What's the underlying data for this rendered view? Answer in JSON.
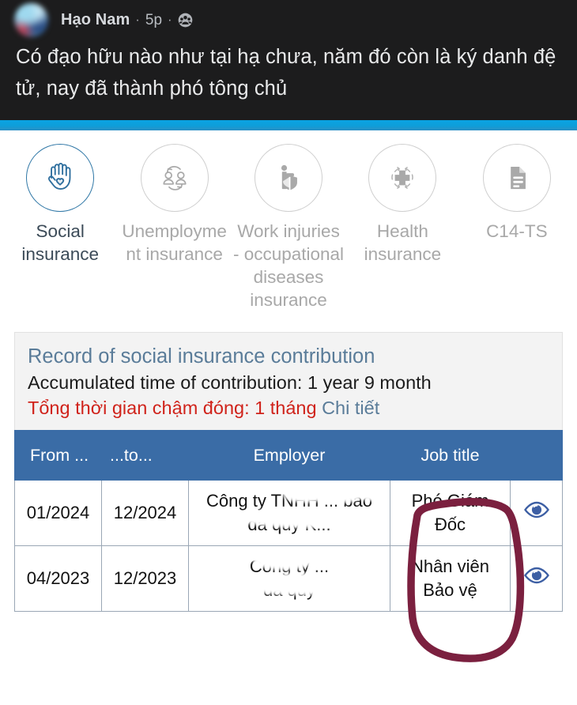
{
  "post": {
    "author": "Hạo Nam",
    "time": "5p",
    "separator": "·",
    "audience_icon": "friends-icon",
    "text": "Có đạo hữu nào như tại hạ chưa, năm đó còn là ký danh đệ tử, nay đã thành phó tông chủ",
    "background_color": "#1c1c1d",
    "accent_bar_color": "#0aa3e2"
  },
  "services": [
    {
      "label": "Social insurance",
      "icon": "hands-heart-icon",
      "active": true
    },
    {
      "label": "Unemployment insurance",
      "icon": "people-exchange-icon",
      "active": false
    },
    {
      "label": "Work injuries - occupational diseases insurance",
      "icon": "worker-shield-icon",
      "active": false
    },
    {
      "label": "Health insurance",
      "icon": "medical-cross-cycle-icon",
      "active": false
    },
    {
      "label": "C14-TS",
      "icon": "document-icon",
      "active": false
    }
  ],
  "record": {
    "title": "Record of social insurance contribution",
    "accumulated": "Accumulated time of contribution: 1 year 9 month",
    "late_label": "Tổng thời gian chậm đóng: 1 tháng",
    "detail_link": "Chi tiết",
    "title_color": "#5a7c99",
    "late_color": "#d0231b"
  },
  "table": {
    "header_color": "#3a6ca6",
    "columns": [
      "From ...",
      "...to...",
      "Employer",
      "Job title",
      ""
    ],
    "rows": [
      {
        "from": "01/2024",
        "to": "12/2024",
        "employer_line1": "Công ty TNHH  ... bao",
        "employer_line2": "đá quý K...",
        "job_title": "Phó Giám Đốc",
        "action_icon": "eye-icon"
      },
      {
        "from": "04/2023",
        "to": "12/2023",
        "employer_line1": "Công ty ...",
        "employer_line2": "đá quý",
        "job_title": "Nhân viên Bảo vệ",
        "action_icon": "eye-icon"
      }
    ],
    "eye_icon_color": "#3d5fa4"
  },
  "annotation": {
    "shape": "hand-drawn-oval",
    "color": "#7b203f",
    "target": "job-title-column"
  }
}
